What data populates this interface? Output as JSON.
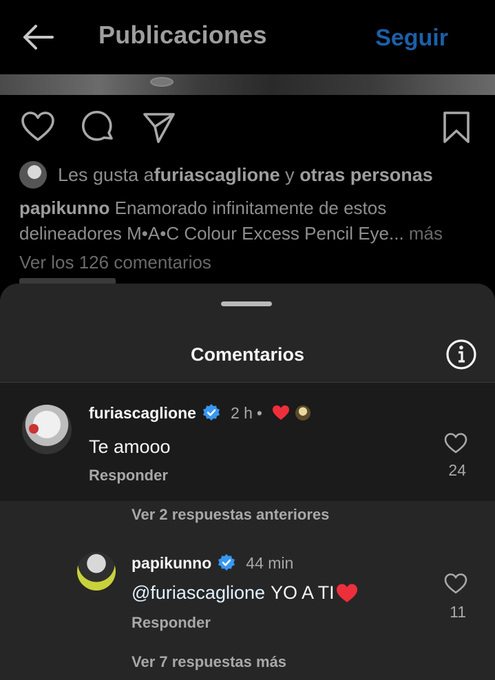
{
  "header": {
    "title": "Publicaciones",
    "follow_label": "Seguir"
  },
  "colors": {
    "accent_blue": "#1c5fa8",
    "verified_blue": "#3897f0",
    "heart_red": "#ed2f3b",
    "sheet_bg": "#262626",
    "highlight_bg": "#1b1b1b"
  },
  "post": {
    "likes_prefix": "Les gusta a ",
    "likes_user": "furiascaglione",
    "likes_mid": " y ",
    "likes_others": "otras personas",
    "caption_user": "papikunno",
    "caption_text": " Enamorado infinitamente de estos delineadores M•A•C Colour Excess Pencil Eye...",
    "caption_more": " más",
    "view_comments": "Ver los 126 comentarios"
  },
  "icons": {
    "back": "arrow-left-icon",
    "like": "heart-outline-icon",
    "comment": "speech-bubble-icon",
    "share": "paper-plane-icon",
    "save": "bookmark-icon",
    "info": "info-circle-icon",
    "verified": "verified-badge-icon"
  },
  "comments_sheet": {
    "title": "Comentarios",
    "comments": [
      {
        "username": "furiascaglione",
        "time": "2 h",
        "separator": "•",
        "text": "Te amooo",
        "reply_label": "Responder",
        "like_count": "24"
      }
    ],
    "view_previous_replies": "Ver 2 respuestas anteriores",
    "reply": {
      "username": "papikunno",
      "time": "44 min",
      "mention": "@furiascaglione",
      "text": "YO A TI",
      "reply_label": "Responder",
      "like_count": "11"
    },
    "view_more_replies": "Ver 7 respuestas más"
  }
}
